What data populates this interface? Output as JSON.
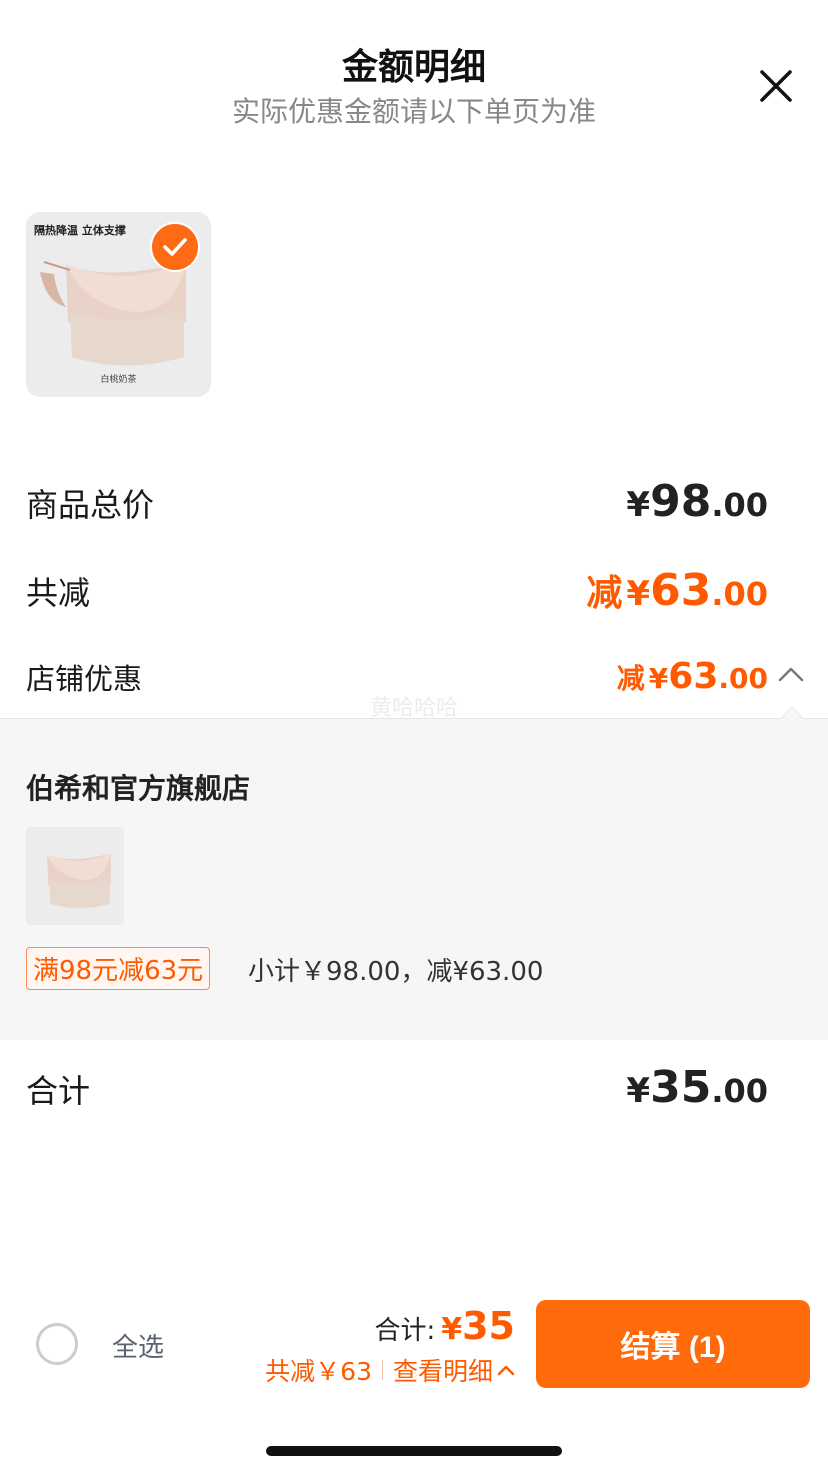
{
  "header": {
    "title": "金额明细",
    "subtitle": "实际优惠金额请以下单页为准"
  },
  "product": {
    "image_tag": "隔热降温 立体支撑",
    "image_caption": "白桃奶茶",
    "selected": true
  },
  "summary": {
    "total_label": "商品总价",
    "total_currency": "¥",
    "total_int": "98",
    "total_dec": ".00",
    "discount_label": "共减",
    "discount_prefix": "减",
    "discount_currency": "¥",
    "discount_int": "63",
    "discount_dec": ".00",
    "store_discount_label": "店铺优惠",
    "store_discount_prefix": "减",
    "store_discount_currency": "¥",
    "store_discount_int": "63",
    "store_discount_dec": ".00"
  },
  "store": {
    "name": "伯希和官方旗舰店",
    "promo_tag": "满98元减63元",
    "promo_detail": "小计￥98.00，减¥63.00"
  },
  "grand_total": {
    "label": "合计",
    "currency": "¥",
    "int": "35",
    "dec": ".00"
  },
  "watermark": "黄哈哈哈",
  "bottom_bar": {
    "select_all": "全选",
    "sum_label": "合计:",
    "sum_currency": "¥",
    "sum_value": "35",
    "save_text": "共减￥63",
    "view_detail": "查看明细",
    "checkout": "结算 (1)"
  },
  "colors": {
    "accent": "#ff5a00",
    "button": "#ff6a0a",
    "panel_bg": "#f6f6f6"
  }
}
